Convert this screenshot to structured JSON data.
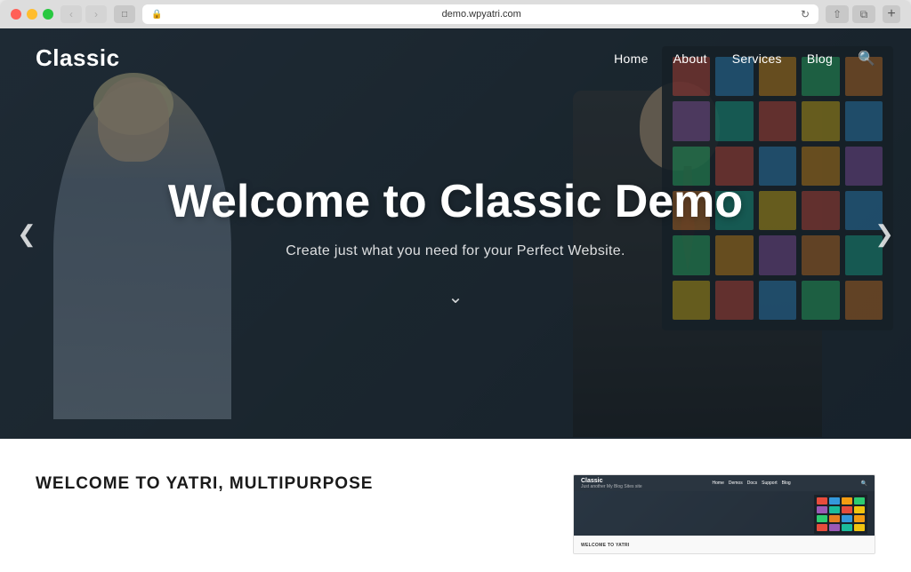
{
  "browser": {
    "url": "demo.wpyatri.com",
    "nav_back_disabled": true,
    "nav_forward_disabled": true
  },
  "site": {
    "logo": "Classic",
    "nav": {
      "links": [
        "Home",
        "About",
        "Services",
        "Blog"
      ]
    },
    "hero": {
      "title": "Welcome to Classic Demo",
      "subtitle": "Create just what you need for your Perfect Website.",
      "carousel_prev": "❮",
      "carousel_next": "❯",
      "arrow_down": "⌄"
    },
    "below_fold": {
      "title": "WELCOME TO YATRI, MULTIPURPOSE"
    },
    "preview": {
      "logo": "Classic",
      "tagline": "Just another My Blog Sites site",
      "nav_items": [
        "Home",
        "Demos",
        "Docs",
        "Support",
        "Blog"
      ]
    }
  },
  "sticky_colors": [
    "#e74c3c",
    "#3498db",
    "#f39c12",
    "#2ecc71",
    "#e67e22",
    "#9b59b6",
    "#1abc9c",
    "#e74c3c",
    "#f1c40f",
    "#3498db",
    "#2ecc71",
    "#e74c3c",
    "#3498db",
    "#f39c12",
    "#9b59b6",
    "#e67e22",
    "#1abc9c",
    "#f1c40f",
    "#e74c3c",
    "#3498db",
    "#2ecc71",
    "#f39c12",
    "#9b59b6",
    "#e67e22",
    "#1abc9c",
    "#f1c40f",
    "#e74c3c",
    "#3498db",
    "#2ecc71",
    "#e67e22"
  ],
  "preview_sticky_colors": [
    "#e74c3c",
    "#3498db",
    "#f39c12",
    "#2ecc71",
    "#9b59b6",
    "#1abc9c",
    "#e74c3c",
    "#f1c40f",
    "#2ecc71",
    "#e67e22",
    "#3498db",
    "#f39c12",
    "#e74c3c",
    "#9b59b6",
    "#1abc9c",
    "#f1c40f"
  ]
}
